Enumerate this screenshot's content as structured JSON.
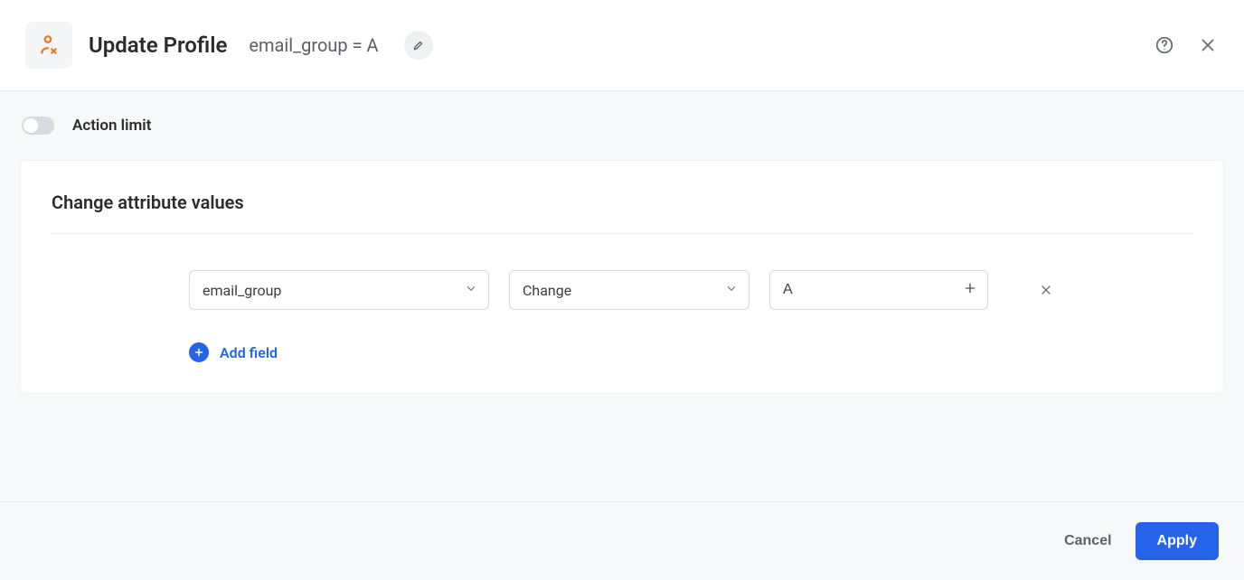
{
  "header": {
    "title": "Update Profile",
    "subtitle": "email_group = A"
  },
  "action_limit": {
    "label": "Action limit",
    "enabled": false
  },
  "card": {
    "title": "Change attribute values",
    "rows": [
      {
        "attribute": "email_group",
        "operation": "Change",
        "value": "A"
      }
    ],
    "add_field_label": "Add field"
  },
  "footer": {
    "cancel_label": "Cancel",
    "apply_label": "Apply"
  }
}
